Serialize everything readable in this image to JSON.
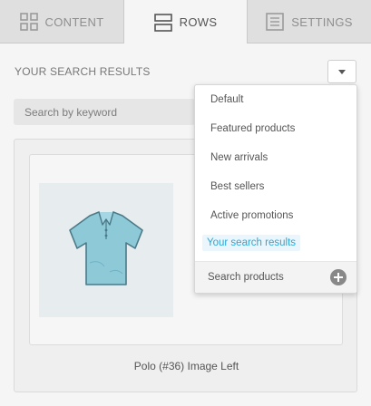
{
  "tabs": [
    {
      "label": "CONTENT",
      "icon": "grid-icon",
      "active": false
    },
    {
      "label": "ROWS",
      "icon": "rows-icon",
      "active": true
    },
    {
      "label": "SETTINGS",
      "icon": "settings-list-icon",
      "active": false
    }
  ],
  "section": {
    "title": "YOUR SEARCH RESULTS",
    "dropdown_icon": "caret-down-icon"
  },
  "search": {
    "placeholder": "Search by keyword",
    "value": ""
  },
  "results": {
    "items": [
      {
        "caption": "Polo (#36) Image Left",
        "image": "polo-shirt-illustration"
      }
    ]
  },
  "menu": {
    "items": [
      {
        "label": "Default"
      },
      {
        "label": "Featured products"
      },
      {
        "label": "New arrivals"
      },
      {
        "label": "Best sellers"
      },
      {
        "label": "Active promotions"
      },
      {
        "label": "Your search results",
        "selected": true
      }
    ],
    "footer": {
      "label": "Search products",
      "icon": "plus-circle-icon"
    }
  },
  "colors": {
    "accent": "#2aa7d8",
    "tab_bar": "#dfdfdf",
    "panel": "#f5f5f5",
    "shirt": "#8ec9d8"
  }
}
